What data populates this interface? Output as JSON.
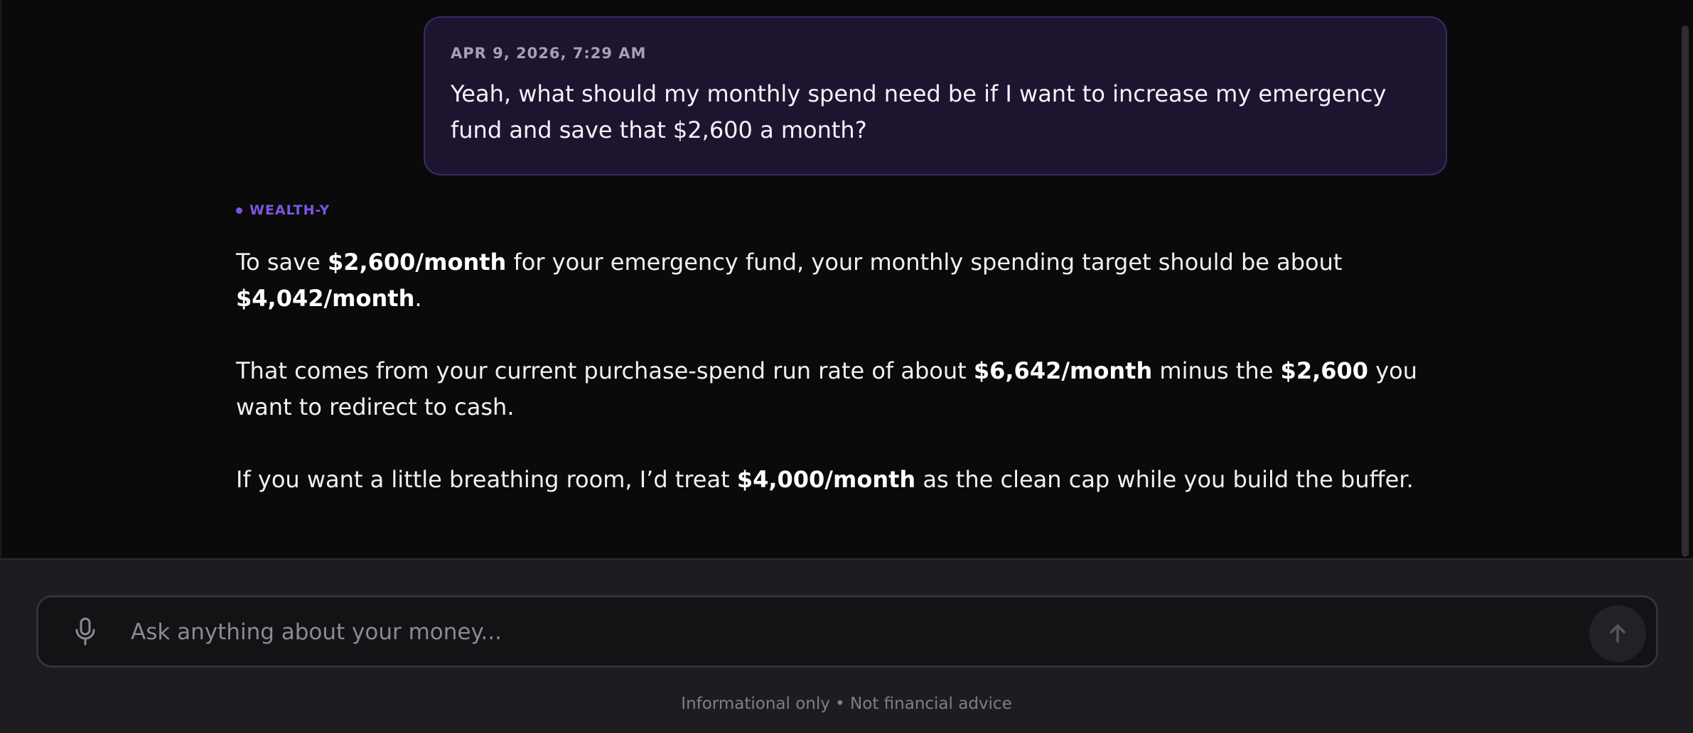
{
  "colors": {
    "background": "#0a0a0b",
    "user_bubble": "#1d1530",
    "user_bubble_border": "#3a2a66",
    "accent": "#7d55e6",
    "composer_area": "#1d1d21"
  },
  "user_message": {
    "timestamp": "APR 9, 2026, 7:29 AM",
    "text": "Yeah, what should my monthly spend need be if I want to increase my emergency fund and save that $2,600 a month?"
  },
  "assistant": {
    "name": "WEALTH-Y",
    "p1": {
      "a": "To save ",
      "b": "$2,600/month",
      "c": " for your emergency fund, your monthly spending target should be about ",
      "d": "$4,042/month",
      "e": "."
    },
    "p2": {
      "a": "That comes from your current purchase-spend run rate of about ",
      "b": "$6,642/month",
      "c": " minus the ",
      "d": "$2,600",
      "e": " you want to redirect to cash."
    },
    "p3": {
      "a": "If you want a little breathing room, I’d treat ",
      "b": "$4,000/month",
      "c": " as the clean cap while you build the buffer."
    }
  },
  "composer": {
    "placeholder": "Ask anything about your money...",
    "value": "",
    "mic_icon": "microphone-icon",
    "send_icon": "arrow-up-icon"
  },
  "footer": {
    "disclaimer": "Informational only • Not financial advice"
  }
}
